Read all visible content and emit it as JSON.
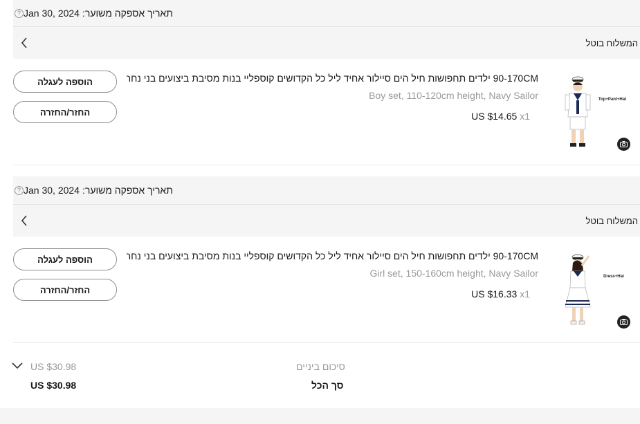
{
  "groups": [
    {
      "delivery_label": "תאריך אספקה משוער:",
      "delivery_date": "Jan 30, 2024",
      "shipping_status": "המשלוח בוטל",
      "item": {
        "title": "90-170CM ילדים תחפושות חיל הים סיילור אחיד ליל כל הקדושים קוספליי בנות מסיבת ביצועים בני נחתים צי ...",
        "variant": "Boy set, 110-120cm height, Navy Sailor",
        "quantity": "x1",
        "price": "US $14.65",
        "image_caption": "Top+Pant+Hat",
        "add_to_cart_label": "הוספה לעגלה",
        "return_label": "החזר/החזרה"
      }
    },
    {
      "delivery_label": "תאריך אספקה משוער:",
      "delivery_date": "Jan 30, 2024",
      "shipping_status": "המשלוח בוטל",
      "item": {
        "title": "90-170CM ילדים תחפושות חיל הים סיילור אחיד ליל כל הקדושים קוספליי בנות מסיבת ביצועים בני נחתים צי ...",
        "variant": "Girl set, 150-160cm height, Navy Sailor",
        "quantity": "x1",
        "price": "US $16.33",
        "image_caption": "Dress+Hat",
        "add_to_cart_label": "הוספה לעגלה",
        "return_label": "החזר/החזרה"
      }
    }
  ],
  "summary": {
    "subtotal_label": "סיכום ביניים",
    "subtotal_value": "US $30.98",
    "total_label": "סך הכל",
    "total_value": "US $30.98"
  },
  "icons": {
    "help": "help-circle-icon",
    "chevron": "chevron-left-icon",
    "camera": "camera-icon",
    "expand": "chevron-down-icon"
  }
}
